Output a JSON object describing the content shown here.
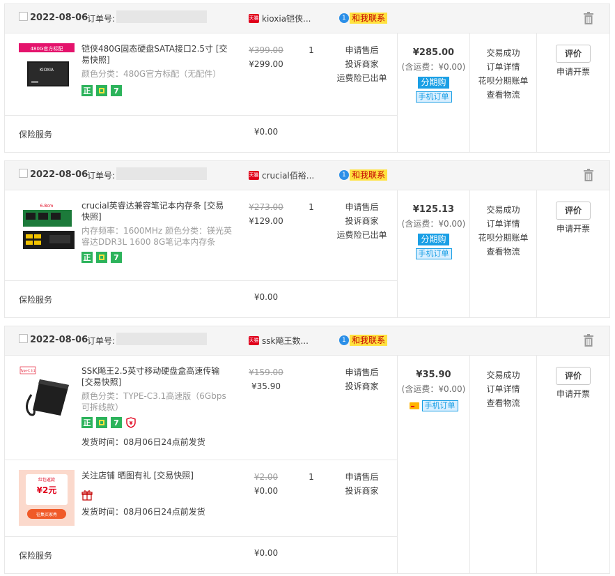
{
  "labels": {
    "order_no": "订单号:",
    "contact": "和我联系",
    "insurance": "保险服务",
    "tmall": "天猫",
    "fenqi": "分期购",
    "phone_order": "手机订单",
    "rate": "评价",
    "invoice": "申请开票"
  },
  "orders": [
    {
      "date": "2022-08-06",
      "shop": "kioxia铠侠...",
      "total": "¥285.00",
      "shipping": "(含运费：¥0.00)",
      "insurance_price": "¥0.00",
      "status": [
        "交易成功",
        "订单详情",
        "花呗分期账单",
        "查看物流"
      ],
      "items": [
        {
          "title": "铠侠480G固态硬盘SATA接口2.5寸 [交易快照]",
          "spec": "颜色分类：480G官方标配（无配件）",
          "thumb_label": "480G官方标配",
          "thumb_brand": "KIOXIA",
          "orig_price": "¥399.00",
          "price": "¥299.00",
          "qty": "1",
          "service": [
            "申请售后",
            "投诉商家",
            "运费险已出单"
          ],
          "badges": [
            "正",
            "bao",
            "7"
          ]
        }
      ]
    },
    {
      "date": "2022-08-06",
      "shop": "crucial佰裕...",
      "total": "¥125.13",
      "shipping": "(含运费：¥0.00)",
      "insurance_price": "¥0.00",
      "status": [
        "交易成功",
        "订单详情",
        "花呗分期账单",
        "查看物流"
      ],
      "items": [
        {
          "title": "crucial英睿达兼容笔记本内存条 [交易快照]",
          "spec": "内存频率：1600MHz  颜色分类：镁光英睿达DDR3L 1600 8G笔记本内存条",
          "thumb_label": "6.8cm",
          "orig_price": "¥273.00",
          "price": "¥129.00",
          "qty": "1",
          "service": [
            "申请售后",
            "投诉商家",
            "运费险已出单"
          ],
          "badges": [
            "正",
            "bao",
            "7"
          ]
        }
      ]
    },
    {
      "date": "2022-08-06",
      "shop": "ssk飚王数...",
      "total": "¥35.90",
      "shipping": "(含运费：¥0.00)",
      "insurance_price": "¥0.00",
      "status": [
        "交易成功",
        "订单详情",
        "查看物流"
      ],
      "items": [
        {
          "title": "SSK飚王2.5英寸移动硬盘盒高速传输 [交易快照]",
          "spec": "颜色分类：TYPE-C3.1高速版（6Gbps可拆线款）",
          "thumb_label": "Type-C 3.1",
          "orig_price": "¥159.00",
          "price": "¥35.90",
          "qty": "",
          "service": [
            "申请售后",
            "投诉商家"
          ],
          "badges": [
            "正",
            "bao",
            "7",
            "shield"
          ],
          "ship_time": "发货时间：08月06日24点前发货"
        },
        {
          "title": "关注店铺 晒图有礼 [交易快照]",
          "thumb_top": "红包返款",
          "thumb_amount": "¥2元",
          "thumb_btn": "征集买家秀",
          "orig_price": "¥2.00",
          "price": "¥0.00",
          "qty": "1",
          "service": [
            "申请售后",
            "投诉商家"
          ],
          "badges": [
            "gift"
          ],
          "ship_time": "发货时间：08月06日24点前发货"
        }
      ]
    }
  ]
}
